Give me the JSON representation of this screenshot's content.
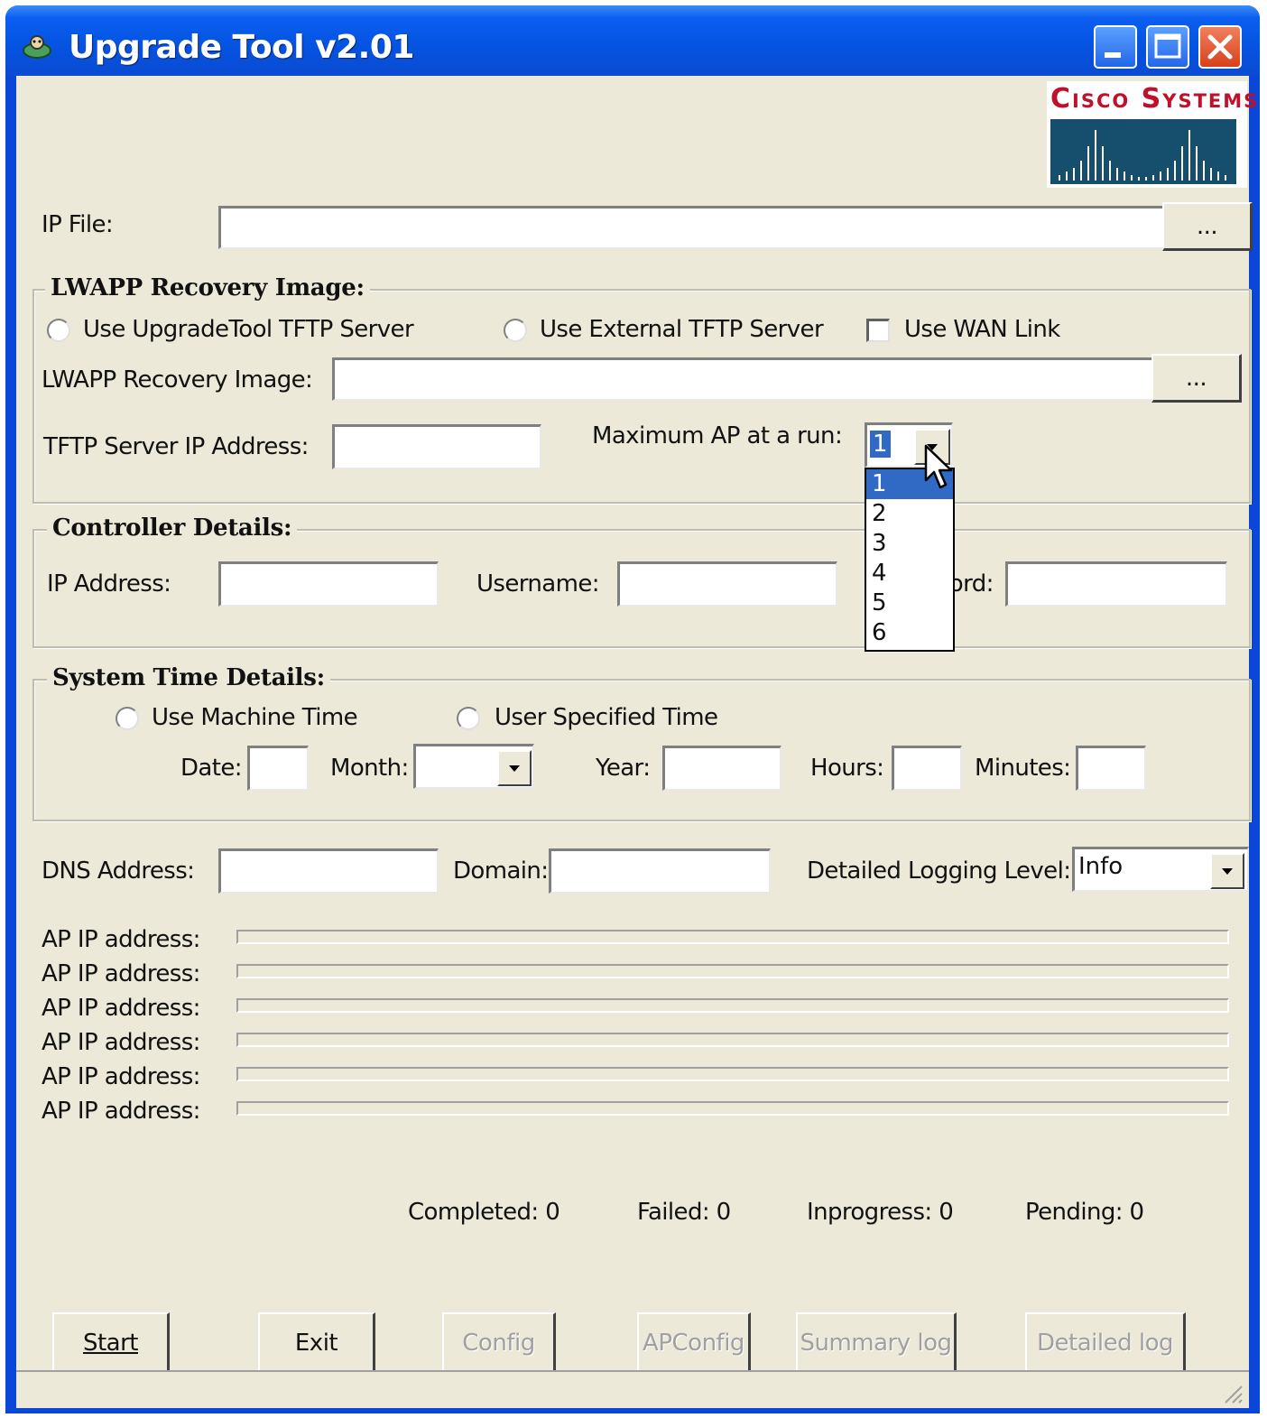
{
  "window": {
    "title": "Upgrade Tool v2.01"
  },
  "logo": {
    "text": "Cisco Systems"
  },
  "ip_file": {
    "label": "IP File:",
    "value": "",
    "browse_label": "..."
  },
  "lwapp": {
    "legend": "LWAPP Recovery Image:",
    "radio_internal": "Use UpgradeTool TFTP Server",
    "radio_external": "Use External TFTP Server",
    "wan_link": "Use WAN Link",
    "image_label": "LWAPP Recovery Image:",
    "image_value": "",
    "image_browse_label": "...",
    "tftp_label": "TFTP Server IP Address:",
    "tftp_value": "",
    "max_ap_label": "Maximum AP at a run:",
    "max_ap_value": "1",
    "max_ap_options": [
      "1",
      "2",
      "3",
      "4",
      "5",
      "6"
    ]
  },
  "controller": {
    "legend": "Controller Details:",
    "ip_label": "IP Address:",
    "username_label": "Username:",
    "password_label": "Password:"
  },
  "systime": {
    "legend": "System Time Details:",
    "radio_machine": "Use Machine Time",
    "radio_user": "User Specified Time",
    "date_label": "Date:",
    "month_label": "Month:",
    "year_label": "Year:",
    "hours_label": "Hours:",
    "minutes_label": "Minutes:"
  },
  "misc": {
    "dns_label": "DNS Address:",
    "domain_label": "Domain:",
    "logging_label": "Detailed Logging Level:",
    "logging_value": "Info"
  },
  "ap_rows": [
    {
      "label": "AP IP address:",
      "progress": 0
    },
    {
      "label": "AP IP address:",
      "progress": 0
    },
    {
      "label": "AP IP address:",
      "progress": 0
    },
    {
      "label": "AP IP address:",
      "progress": 0
    },
    {
      "label": "AP IP address:",
      "progress": 0
    },
    {
      "label": "AP IP address:",
      "progress": 0
    }
  ],
  "stats": {
    "completed": "Completed: 0",
    "failed": "Failed:  0",
    "inprogress": "Inprogress: 0",
    "pending": "Pending: 0"
  },
  "buttons": {
    "start": "Start",
    "exit": "Exit",
    "config": "Config",
    "apconfig": "APConfig",
    "summary_log": "Summary log",
    "detailed_log": "Detailed log"
  },
  "colors": {
    "titlebar": "#0553e0",
    "client_bg": "#ece9d8",
    "selection": "#316ac5",
    "close_button": "#d8401a",
    "logo_red": "#c0102a",
    "logo_blue": "#164f6d"
  },
  "icons": [
    "app-icon",
    "minimize-icon",
    "maximize-icon",
    "close-icon",
    "dropdown-arrow-icon",
    "mouse-cursor-icon",
    "resize-grip-icon"
  ]
}
